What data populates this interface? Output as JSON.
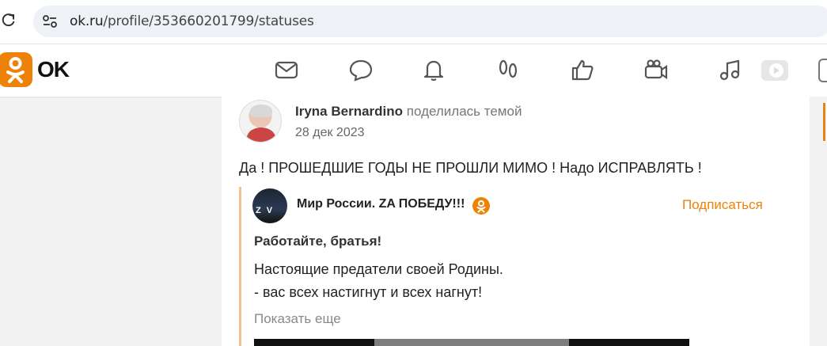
{
  "browser": {
    "url_host": "ok.ru",
    "url_path": "/profile/353660201799/statuses",
    "reload_icon": "reload-icon",
    "site_info_icon": "tune-icon"
  },
  "toolbar": {
    "logo_text": "OK",
    "brand_color": "#ee8208",
    "nav_icons": [
      "mail-icon",
      "chat-icon",
      "bell-icon",
      "footprints-icon",
      "like-icon",
      "video-camera-icon",
      "music-icon",
      "play-icon"
    ]
  },
  "post": {
    "author_name": "Iryna Bernardino",
    "author_action": "поделилась темой",
    "date": "28 дек 2023",
    "text": "Да ! ПРОШЕДШИЕ ГОДЫ НЕ ПРОШЛИ МИМО ! Надо  ИСПРАВЛЯТЬ !",
    "shared": {
      "group_name": "Мир России. ZA ПОБЕДУ!!!",
      "subscribe_label": "Подписаться",
      "title": "Работайте, братья!",
      "line1": "Настоящие предатели своей Родины.",
      "line2": "- вас всех настигнут и всех нагнут!",
      "show_more": "Показать еще"
    }
  }
}
